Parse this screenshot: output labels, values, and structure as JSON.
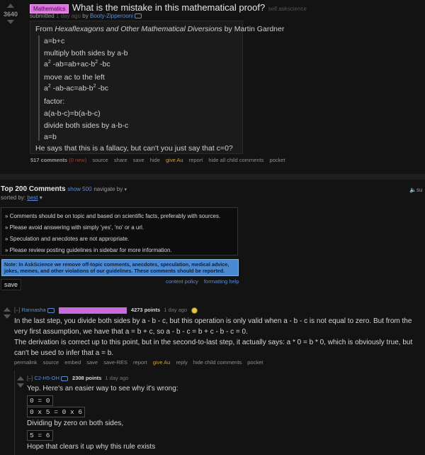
{
  "post": {
    "score": "3640",
    "flair": "Mathematics",
    "title": "What is the mistake in this mathematical proof?",
    "domain": "self.askscience",
    "submitted_prefix": "submitted",
    "submitted_time": "1 day ago",
    "by": "by",
    "author": "Booty-Zipperooni",
    "selftext": {
      "intro_pre": "From ",
      "intro_book": "Hexaflexagons and Other Mathematical Diversions",
      "intro_post": " by Martin Gardner",
      "lines": [
        {
          "text": "a=b+c"
        },
        {
          "text": "multiply both sides by a-b"
        },
        {
          "pre": "a",
          "sup1": "2",
          "mid": " -ab=ab+ac-b",
          "sup2": "2",
          "post": " -bc"
        },
        {
          "text": "move ac to the left"
        },
        {
          "pre": "a",
          "sup1": "2",
          "mid": " -ab-ac=ab-b",
          "sup2": "2",
          "post": " -bc"
        },
        {
          "text": "factor:"
        },
        {
          "text": "a(a-b-c)=b(a-b-c)"
        },
        {
          "text": "divide both sides by a-b-c"
        },
        {
          "text": "a=b"
        }
      ],
      "outro": "He says that this is a fallacy, but can't you just say that c=0?"
    },
    "buttons": {
      "comments": "517 comments",
      "new": "(0 new)",
      "source": "source",
      "share": "share",
      "save": "save",
      "hide": "hide",
      "give": "give Au",
      "report": "report",
      "hideall": "hide all child comments",
      "pocket": "pocket"
    }
  },
  "comments_header": {
    "title": "Top 200 Comments",
    "show": "show 500",
    "navigate": "navigate by",
    "sorted_by": "sorted by:",
    "sort": "best",
    "subscribe": "su"
  },
  "rules": [
    "Comments should be on topic and based on scientific facts, preferably with sources.",
    "Please avoid answering with simply 'yes', 'no' or a url.",
    "Speculation and anecdotes are not appropriate.",
    "Please review posting guidelines in sidebar for more information."
  ],
  "note": "Note: In AskScience we remove off-topic comments, anecdotes, speculation, medical advice, jokes, memes, and other violations of our guidelines. These comments should be reported.",
  "save_button": "save",
  "policy_links": {
    "content": "content policy",
    "formatting": "formatting help"
  },
  "comment1": {
    "collapse": "[–]",
    "author": "Rannasha",
    "points": "4273 points",
    "time": "1 day ago",
    "p1": "In the last step, you divide both sides by a - b - c, but this operation is only valid when a - b - c is not equal to zero. But from the very first assumption, we have that a = b + c, so a - b - c = b + c - b - c = 0.",
    "p2": "The derivation is correct up to this point, but in the second-to-last step, it actually says: a * 0 = b * 0, which is obviously true, but can't be used to infer that a = b.",
    "buttons": [
      "permalink",
      "source",
      "embed",
      "save",
      "save-RES",
      "report",
      "give Au",
      "reply",
      "hide child comments",
      "pocket"
    ]
  },
  "comment2": {
    "collapse": "[–]",
    "author": "C2-H5-OH",
    "points": "2308 points",
    "time": "1 day ago",
    "intro": "Yep. Here's an easier way to see why it's wrong:",
    "code1": "0 = 0",
    "code2": "0 x 5 = 0 x 6",
    "mid": "Dividing by zero on both sides,",
    "code3": "5 = 6",
    "outro": "Hope that clears it up why this rule exists"
  }
}
